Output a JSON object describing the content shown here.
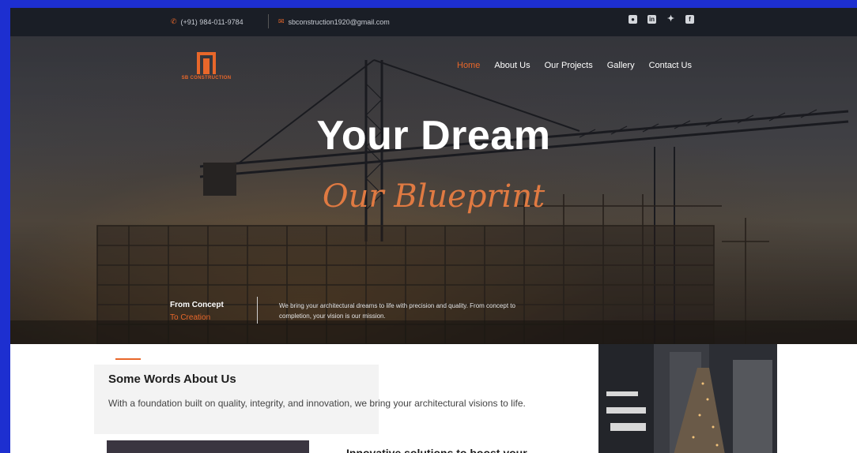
{
  "topbar": {
    "phone": "(+91) 984-011-9784",
    "email": "sbconstruction1920@gmail.com",
    "socials": [
      "instagram-icon",
      "linkedin-icon",
      "twitter-icon",
      "facebook-icon"
    ]
  },
  "brand": {
    "name": "SB CONSTRUCTION",
    "color": "#e8672a"
  },
  "nav": {
    "items": [
      "Home",
      "About Us",
      "Our Projects",
      "Gallery",
      "Contact Us"
    ],
    "active": "Home"
  },
  "hero": {
    "title": "Your Dream",
    "script": "Our Blueprint",
    "concept_line1": "From Concept",
    "concept_line2": "To Creation",
    "description": "We bring your architectural dreams to life with precision and quality. From concept to completion, your vision is our mission."
  },
  "about": {
    "title": "Some Words About Us",
    "text": "With a foundation built on quality, integrity, and innovation, we bring your architectural visions to life.",
    "next_heading": "Innovative solutions to boost your"
  }
}
